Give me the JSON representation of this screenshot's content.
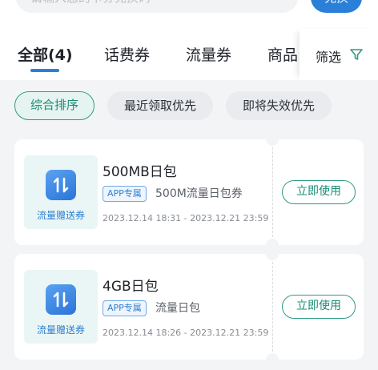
{
  "search": {
    "placeholder": "请输入您的卡券兑换码",
    "redeem_label": "兑换"
  },
  "tabs": [
    {
      "label": "全部(4)",
      "active": true
    },
    {
      "label": "话费券",
      "active": false
    },
    {
      "label": "流量券",
      "active": false
    },
    {
      "label": "商品",
      "active": false
    }
  ],
  "filter": {
    "label": "筛选",
    "icon": "funnel-icon"
  },
  "sort": [
    {
      "label": "综合排序",
      "active": true
    },
    {
      "label": "最近领取优先",
      "active": false
    },
    {
      "label": "即将失效优先",
      "active": false
    }
  ],
  "coupons": [
    {
      "thumb_label": "流量赠送券",
      "title": "500MB日包",
      "tag": "APP专属",
      "desc": "500M流量日包券",
      "date": "2023.12.14 18:31 - 2023.12.21 23:59",
      "button": "立即使用"
    },
    {
      "thumb_label": "流量赠送券",
      "title": "4GB日包",
      "tag": "APP专属",
      "desc": "流量日包",
      "date": "2023.12.14 18:26 - 2023.12.21 23:59",
      "button": "立即使用"
    }
  ],
  "colors": {
    "accent_blue": "#2a7fd9",
    "accent_green": "#2e9c83",
    "background": "#f3f4f6"
  }
}
